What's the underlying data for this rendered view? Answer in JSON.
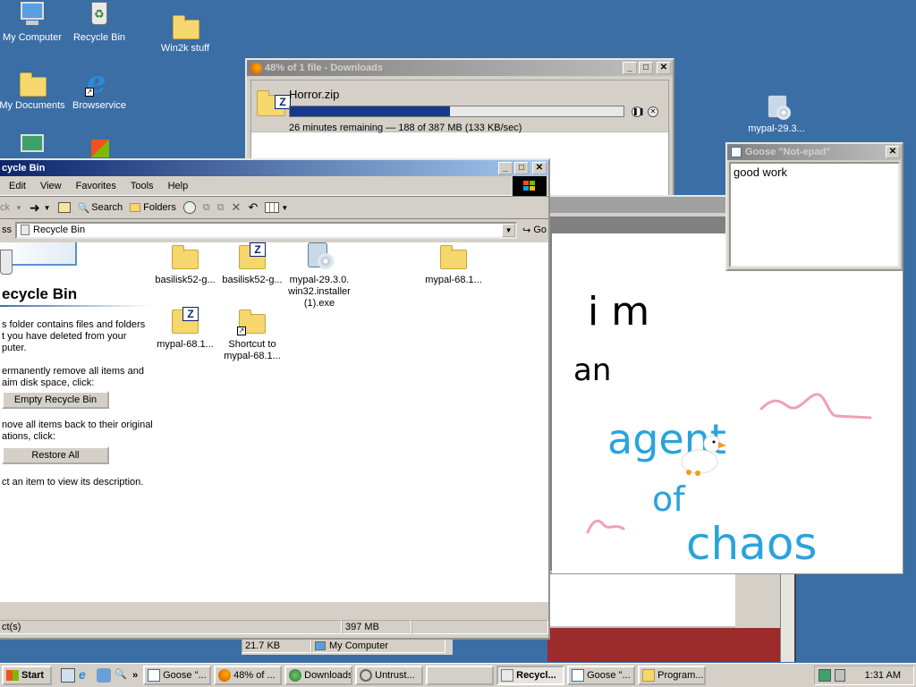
{
  "desktop": {
    "icons": {
      "my_computer": "My Computer",
      "recycle_bin": "Recycle Bin",
      "win2k_stuff": "Win2k stuff",
      "my_documents": "My Documents",
      "browservice": "Browservice",
      "mypal": "mypal-29.3..."
    }
  },
  "downloads": {
    "title": "48% of 1 file - Downloads",
    "filename": "Horror.zip",
    "progress_percent": 48,
    "status": "26 minutes remaining — 188 of 387 MB (133 KB/sec)"
  },
  "paint": {
    "drawing_text": [
      "i m",
      "an",
      "agent",
      "of",
      "chaos"
    ],
    "colors": {
      "black_ink": "#000000",
      "blue_ink": "#2aa3dc",
      "pink_ink": "#f0a0b4"
    }
  },
  "notepad": {
    "title": "Goose \"Not-epad\"",
    "content": "good work"
  },
  "explorer": {
    "title": "cycle Bin",
    "menu": [
      "Edit",
      "View",
      "Favorites",
      "Tools",
      "Help"
    ],
    "toolbar": {
      "back": "ck",
      "search": "Search",
      "folders": "Folders"
    },
    "address": {
      "label": "ss",
      "value": "Recycle Bin",
      "go": "Go"
    },
    "sidebar": {
      "heading": "ecycle Bin",
      "desc": "s folder contains files and folders\nt you have deleted from your\nputer.",
      "remove_text": "ermanently remove all items and\naim disk space, click:",
      "empty_button": "Empty Recycle Bin",
      "restore_text": "nove all items back to their original\nations, click:",
      "restore_button": "Restore All",
      "select_text": "ct an item to view its description."
    },
    "files": [
      {
        "name": "basilisk52-g...",
        "icon": "folder-icon"
      },
      {
        "name": "basilisk52-g...",
        "icon": "zip-folder-icon"
      },
      {
        "name": "mypal-29.3.0.\nwin32.installer\n(1).exe",
        "icon": "installer-icon"
      },
      {
        "name": "mypal-68.1...",
        "icon": "folder-icon"
      },
      {
        "name": "mypal-68.1...",
        "icon": "zip-folder-icon"
      },
      {
        "name": "Shortcut to\nmypal-68.1...",
        "icon": "shortcut-folder-icon"
      }
    ],
    "status": {
      "objects": "ct(s)",
      "size": "397 MB"
    }
  },
  "background_status": {
    "size": "21.7 KB",
    "location": "My Computer"
  },
  "taskbar": {
    "start": "Start",
    "tasks": [
      {
        "label": "Goose \"...",
        "pressed": false
      },
      {
        "label": "48% of ...",
        "pressed": false
      },
      {
        "label": "Downloads",
        "pressed": false
      },
      {
        "label": "Untrust...",
        "pressed": false
      },
      {
        "label": "",
        "pressed": false
      },
      {
        "label": "Recycl...",
        "pressed": true
      },
      {
        "label": "Goose \"...",
        "pressed": false
      },
      {
        "label": "Program...",
        "pressed": false
      }
    ],
    "clock": "1:31 AM"
  }
}
